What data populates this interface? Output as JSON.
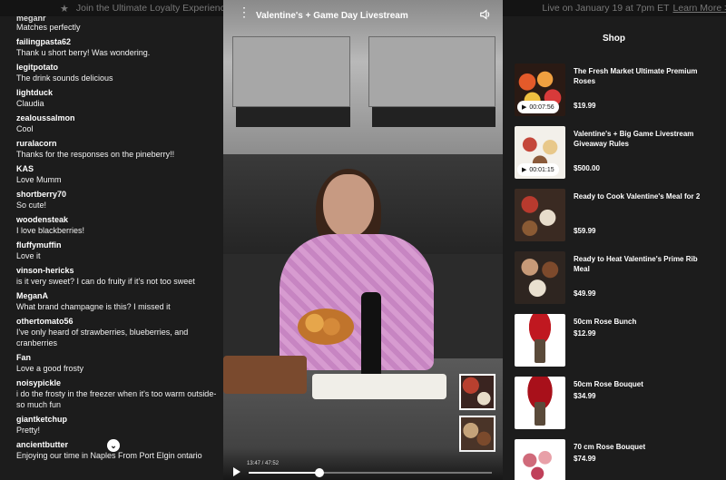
{
  "banner": {
    "text": "Join the Ultimate Loyalty Experience & En",
    "text_tail": "Live on January 19 at 7pm ET",
    "link": "Learn More >"
  },
  "chat": {
    "partial_user": "meganr",
    "messages": [
      {
        "user": "",
        "text": "Matches perfectly"
      },
      {
        "user": "failingpasta62",
        "text": "Thank u short berry! Was wondering."
      },
      {
        "user": "legitpotato",
        "text": "The drink sounds delicious"
      },
      {
        "user": "lightduck",
        "text": "Claudia"
      },
      {
        "user": "zealoussalmon",
        "text": "Cool"
      },
      {
        "user": "ruralacorn",
        "text": "Thanks for the responses on the pineberry!!"
      },
      {
        "user": "KAS",
        "text": "Love Mumm"
      },
      {
        "user": "shortberry70",
        "text": "So cute!"
      },
      {
        "user": "woodensteak",
        "text": "I love blackberries!"
      },
      {
        "user": "fluffymuffin",
        "text": "Love it"
      },
      {
        "user": "vinson-hericks",
        "text": "is it very sweet? I can do fruity if it's not too sweet"
      },
      {
        "user": "MeganA",
        "text": "What brand champagne is this? I missed it"
      },
      {
        "user": "othertomato56",
        "text": "I've only heard of strawberries, blueberries, and cranberries"
      },
      {
        "user": "Fan",
        "text": "Love a good frosty"
      },
      {
        "user": "noisypickle",
        "text": "i do the frosty in the freezer when it's too warm outside- so much fun"
      },
      {
        "user": "giantketchup",
        "text": "Pretty!"
      },
      {
        "user": "ancientbutter",
        "text": "Enjoying our time in Naples From Port Elgin ontario"
      }
    ]
  },
  "video": {
    "title": "Valentine's + Game Day Livestream",
    "current_time": "13:47",
    "total_time": "47:52",
    "progress": 0.29
  },
  "shop": {
    "title": "Shop",
    "products": [
      {
        "name": "The Fresh Market Ultimate Premium Roses",
        "price": "$19.99",
        "duration": "00:07:56",
        "img": "img-roses"
      },
      {
        "name": "Valentine's + Big Game Livestream Giveaway Rules",
        "price": "$500.00",
        "duration": "00:01:15",
        "img": "img-giveaway"
      },
      {
        "name": "Ready to Cook Valentine's Meal for 2",
        "price": "$59.99",
        "duration": "",
        "img": "img-meal"
      },
      {
        "name": "Ready to Heat Valentine's Prime Rib Meal",
        "price": "$49.99",
        "duration": "",
        "img": "img-rib"
      },
      {
        "name": "50cm Rose Bunch",
        "price": "$12.99",
        "duration": "",
        "img": "img-bunch"
      },
      {
        "name": "50cm Rose Bouquet",
        "price": "$34.99",
        "duration": "",
        "img": "img-bouquet"
      },
      {
        "name": "70 cm Rose Bouquet",
        "price": "$74.99",
        "duration": "",
        "img": "img-70"
      }
    ]
  }
}
